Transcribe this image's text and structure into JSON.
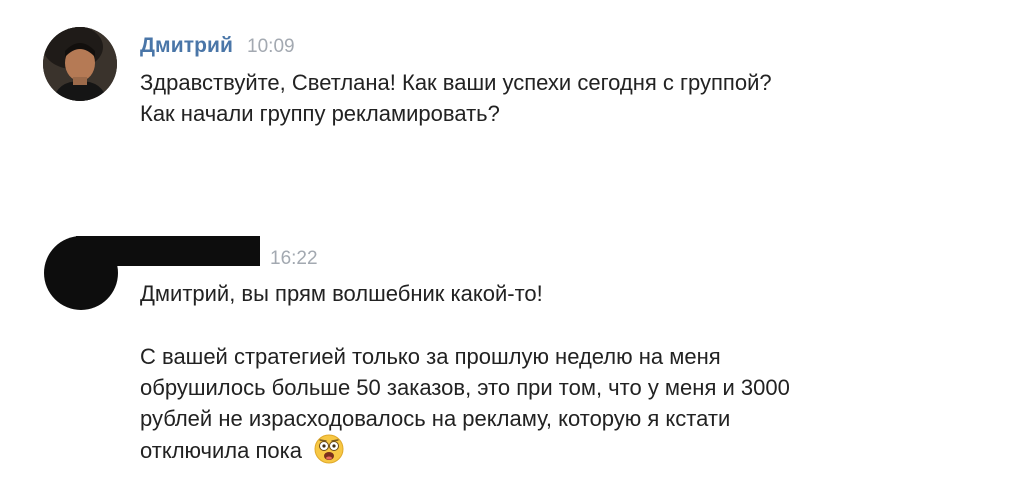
{
  "messages": [
    {
      "author": "Дмитрий",
      "time": "10:09",
      "paragraphs": [
        "Здравствуйте, Светлана! Как ваши успехи сегодня с группой?",
        "Как начали группу рекламировать?"
      ]
    },
    {
      "author": "",
      "time": "16:22",
      "paragraphs": [
        "Дмитрий, вы прям волшебник какой-то!",
        "С вашей стратегией только за прошлую неделю на меня",
        "обрушилось больше 50 заказов, это при том, что у меня и 3000",
        "рублей не израсходовалось на рекламу, которую я кстати",
        "отключила пока"
      ],
      "emoji": "astonished-emoji-icon"
    }
  ],
  "colors": {
    "author": "#4a76a8",
    "time": "#a3a9b1",
    "text": "#222222",
    "redaction": "#0d0d0d"
  }
}
